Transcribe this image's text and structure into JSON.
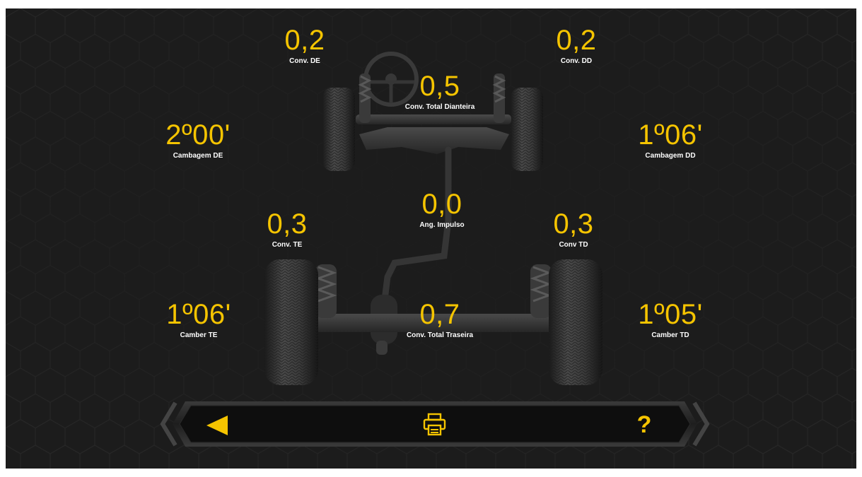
{
  "readings": {
    "conv_de": {
      "value": "0,2",
      "label": "Conv. DE"
    },
    "conv_dd": {
      "value": "0,2",
      "label": "Conv. DD"
    },
    "conv_total_dianteira": {
      "value": "0,5",
      "label": "Conv. Total Dianteira"
    },
    "cambagem_de": {
      "value": "2º00'",
      "label": "Cambagem DE"
    },
    "cambagem_dd": {
      "value": "1º06'",
      "label": "Cambagem DD"
    },
    "ang_impulso": {
      "value": "0,0",
      "label": "Ang. Impulso"
    },
    "conv_te": {
      "value": "0,3",
      "label": "Conv. TE"
    },
    "conv_td": {
      "value": "0,3",
      "label": "Conv TD"
    },
    "camber_te": {
      "value": "1º06'",
      "label": "Camber TE"
    },
    "conv_total_traseira": {
      "value": "0,7",
      "label": "Conv. Total Traseira"
    },
    "camber_td": {
      "value": "1º05'",
      "label": "Camber TD"
    }
  },
  "toolbar": {
    "back_icon": "back-triangle-icon",
    "print_icon": "printer-icon",
    "help_label": "?"
  },
  "colors": {
    "accent": "#f5c400",
    "background": "#1c1c1c",
    "label": "#ffffff",
    "toolbar": "#0e0e0e",
    "toolbar_edge": "#3a3a3a"
  }
}
